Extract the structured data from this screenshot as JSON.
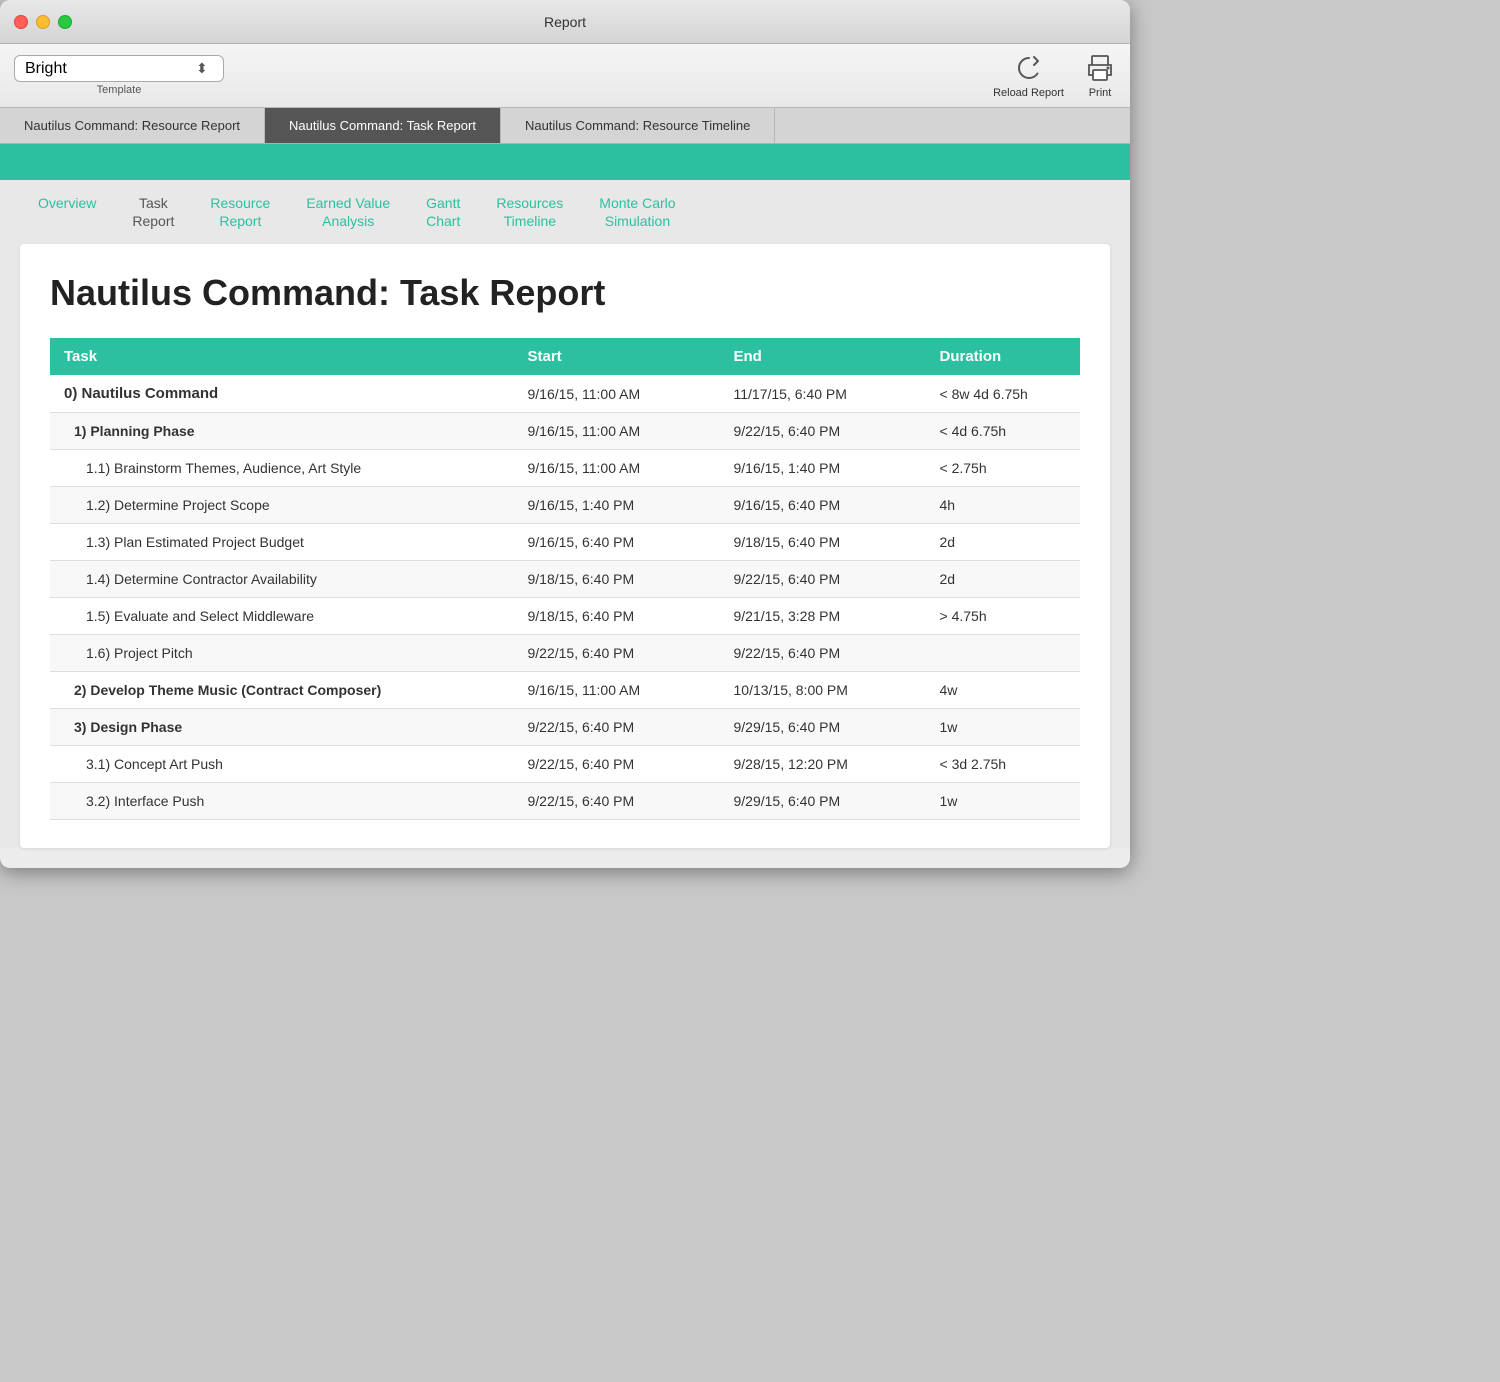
{
  "window": {
    "title": "Report"
  },
  "toolbar": {
    "template_label": "Template",
    "template_value": "Bright",
    "reload_label": "Reload Report",
    "print_label": "Print"
  },
  "tabs": [
    {
      "id": "resource-report",
      "label": "Nautilus Command: Resource Report",
      "active": false
    },
    {
      "id": "task-report",
      "label": "Nautilus Command: Task Report",
      "active": true
    },
    {
      "id": "resource-timeline",
      "label": "Nautilus Command: Resource Timeline",
      "active": false
    }
  ],
  "nav": {
    "items": [
      {
        "id": "overview",
        "label": "Overview",
        "active": true
      },
      {
        "id": "task-report",
        "label": "Task\nReport",
        "active": false
      },
      {
        "id": "resource-report",
        "label": "Resource\nReport",
        "active": true
      },
      {
        "id": "earned-value",
        "label": "Earned Value\nAnalysis",
        "active": true
      },
      {
        "id": "gantt-chart",
        "label": "Gantt\nChart",
        "active": true
      },
      {
        "id": "resources-timeline",
        "label": "Resources\nTimeline",
        "active": true
      },
      {
        "id": "monte-carlo",
        "label": "Monte Carlo\nSimulation",
        "active": true
      }
    ]
  },
  "report": {
    "title": "Nautilus Command: Task Report",
    "table": {
      "headers": [
        "Task",
        "Start",
        "End",
        "Duration"
      ],
      "rows": [
        {
          "level": 0,
          "task": "0) Nautilus Command",
          "start": "9/16/15, 11:00 AM",
          "end": "11/17/15, 6:40 PM",
          "duration": "< 8w 4d 6.75h"
        },
        {
          "level": 1,
          "task": "1) Planning Phase",
          "start": "9/16/15, 11:00 AM",
          "end": "9/22/15, 6:40 PM",
          "duration": "< 4d 6.75h"
        },
        {
          "level": 2,
          "task": "1.1) Brainstorm Themes, Audience, Art Style",
          "start": "9/16/15, 11:00 AM",
          "end": "9/16/15, 1:40 PM",
          "duration": "< 2.75h"
        },
        {
          "level": 2,
          "task": "1.2) Determine Project Scope",
          "start": "9/16/15, 1:40 PM",
          "end": "9/16/15, 6:40 PM",
          "duration": "4h"
        },
        {
          "level": 2,
          "task": "1.3) Plan Estimated Project Budget",
          "start": "9/16/15, 6:40 PM",
          "end": "9/18/15, 6:40 PM",
          "duration": "2d"
        },
        {
          "level": 2,
          "task": "1.4) Determine Contractor Availability",
          "start": "9/18/15, 6:40 PM",
          "end": "9/22/15, 6:40 PM",
          "duration": "2d"
        },
        {
          "level": 2,
          "task": "1.5) Evaluate and Select Middleware",
          "start": "9/18/15, 6:40 PM",
          "end": "9/21/15, 3:28 PM",
          "duration": "> 4.75h"
        },
        {
          "level": 2,
          "task": "1.6) Project Pitch",
          "start": "9/22/15, 6:40 PM",
          "end": "9/22/15, 6:40 PM",
          "duration": ""
        },
        {
          "level": 1,
          "task": "2) Develop Theme Music (Contract Composer)",
          "start": "9/16/15, 11:00 AM",
          "end": "10/13/15, 8:00 PM",
          "duration": "4w"
        },
        {
          "level": 1,
          "task": "3) Design Phase",
          "start": "9/22/15, 6:40 PM",
          "end": "9/29/15, 6:40 PM",
          "duration": "1w"
        },
        {
          "level": 2,
          "task": "3.1) Concept Art Push",
          "start": "9/22/15, 6:40 PM",
          "end": "9/28/15, 12:20 PM",
          "duration": "< 3d 2.75h"
        },
        {
          "level": 2,
          "task": "3.2) Interface Push",
          "start": "9/22/15, 6:40 PM",
          "end": "9/29/15, 6:40 PM",
          "duration": "1w"
        }
      ]
    }
  },
  "colors": {
    "teal": "#2cbfa0",
    "tab_active_bg": "#555555"
  }
}
